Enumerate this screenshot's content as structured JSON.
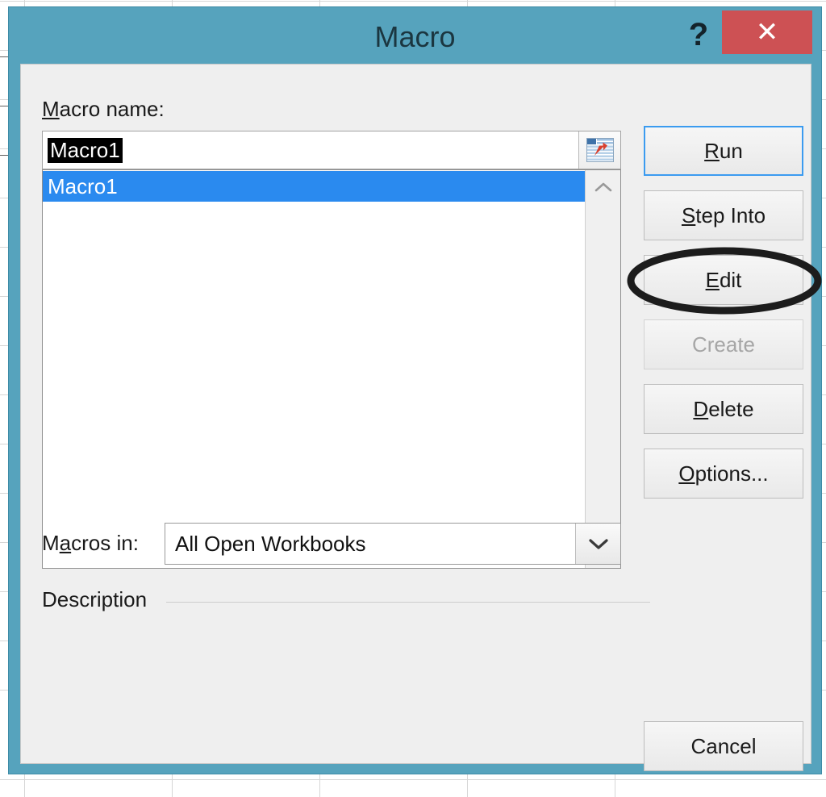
{
  "window": {
    "title": "Macro",
    "help_label": "?",
    "close_label": "✕",
    "titlebar_color": "#56a3bd",
    "close_button_color": "#cd5154"
  },
  "form": {
    "macro_name_label_accel": "M",
    "macro_name_label_rest": "acro name:",
    "macro_name_value": "Macro1",
    "macro_name_selected": true,
    "picker_icon": "worksheet-reference-icon",
    "macros_in_label_pre": "M",
    "macros_in_label_accel": "a",
    "macros_in_label_rest": "cros in:",
    "macros_in_value": "All Open Workbooks",
    "macros_in_arrow_icon": "chevron-down-icon",
    "description_label": "Description",
    "description_text": ""
  },
  "macro_list": {
    "items": [
      {
        "name": "Macro1",
        "selected": true
      }
    ],
    "scrollbar": {
      "up_icon": "chevron-up-icon",
      "down_icon": "chevron-down-icon"
    },
    "selection_color": "#2a8aef"
  },
  "buttons": {
    "run": {
      "accel": "R",
      "rest": "un",
      "state": "default"
    },
    "step_into": {
      "accel": "S",
      "rest": "tep Into",
      "state": "normal"
    },
    "edit": {
      "accel": "E",
      "rest": "dit",
      "state": "normal"
    },
    "create": {
      "accel": "",
      "rest": "Create",
      "state": "disabled"
    },
    "delete": {
      "accel": "D",
      "rest": "elete",
      "state": "normal"
    },
    "options": {
      "accel": "O",
      "rest": "ptions...",
      "state": "normal"
    },
    "cancel": {
      "accel": "",
      "rest": "Cancel",
      "state": "normal"
    }
  },
  "annotation": {
    "shape": "ellipse",
    "target": "edit-button",
    "color": "#1c1c1c"
  }
}
